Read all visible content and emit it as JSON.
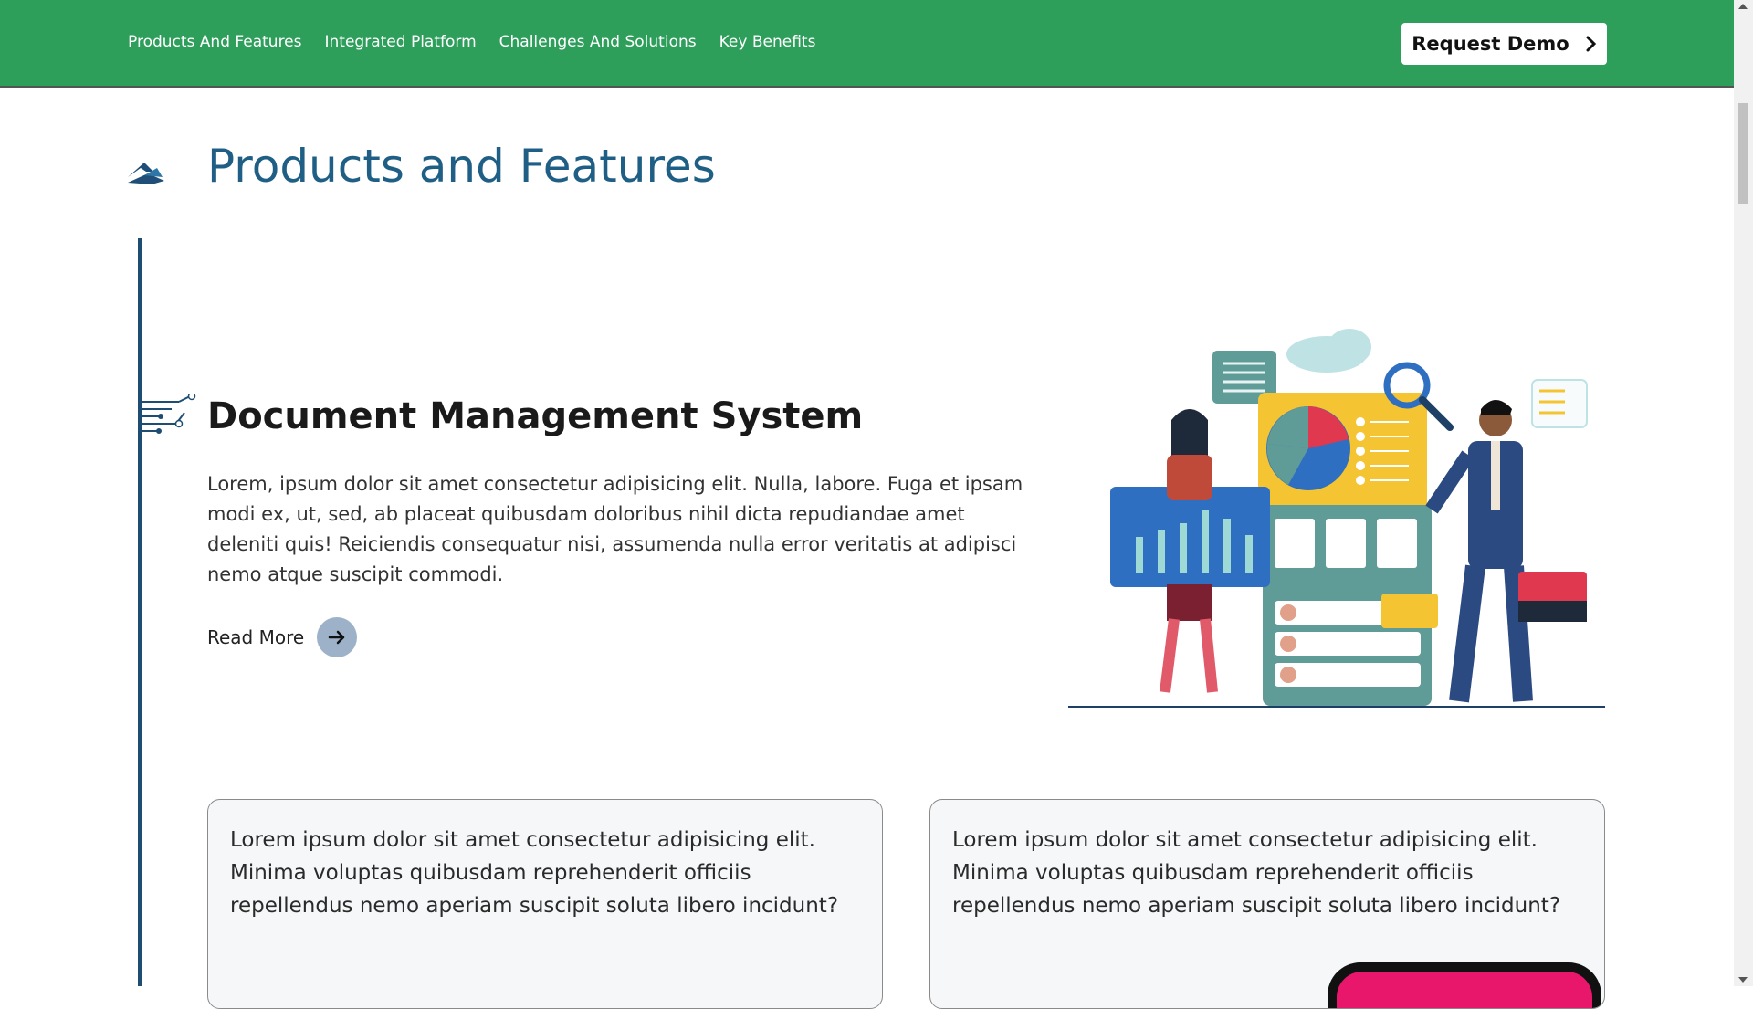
{
  "nav": {
    "links": [
      "Products And Features",
      "Integrated Platform",
      "Challenges And Solutions",
      "Key Benefits"
    ],
    "cta_label": "Request Demo"
  },
  "section": {
    "title": "Products and Features"
  },
  "feature": {
    "title": "Document Management System",
    "description": "Lorem, ipsum dolor sit amet consectetur adipisicing elit. Nulla, labore. Fuga et ipsam modi ex, ut, sed, ab placeat quibusdam doloribus nihil dicta repudiandae amet deleniti quis! Reiciendis consequatur nisi, assumenda nulla error veritatis at adipisci nemo atque suscipit commodi.",
    "read_more": "Read More"
  },
  "cards": [
    {
      "text": "Lorem ipsum dolor sit amet consectetur adipisicing elit. Minima voluptas quibusdam reprehenderit officiis repellendus nemo aperiam suscipit soluta libero incidunt?"
    },
    {
      "text": "Lorem ipsum dolor sit amet consectetur adipisicing elit. Minima voluptas quibusdam reprehenderit officiis repellendus nemo aperiam suscipit soluta libero incidunt?"
    }
  ],
  "colors": {
    "nav_bg": "#2e9e5b",
    "title_blue": "#1f5f85",
    "timeline": "#1e4d73"
  },
  "icons": [
    "logo-mark-icon",
    "circuit-icon",
    "arrow-right-icon",
    "chevron-right-icon"
  ]
}
